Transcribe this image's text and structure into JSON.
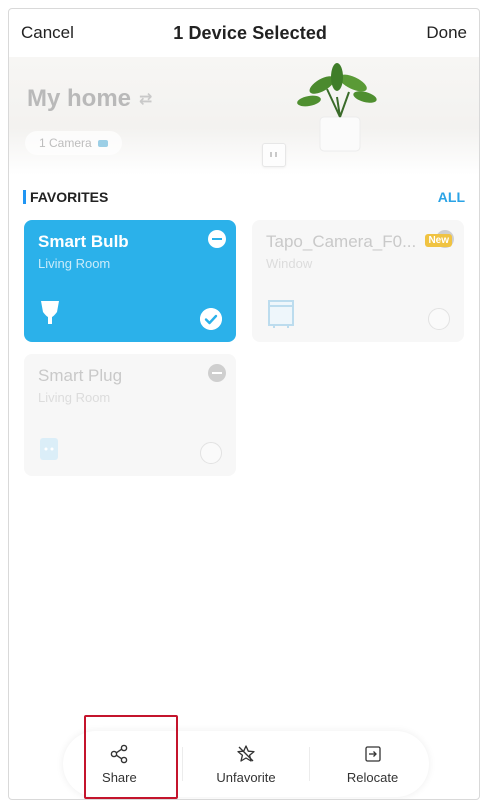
{
  "nav": {
    "cancel": "Cancel",
    "title": "1 Device Selected",
    "done": "Done"
  },
  "home": {
    "title": "My home",
    "camera_count": "1 Camera"
  },
  "favorites": {
    "label": "FAVORITES",
    "all": "ALL"
  },
  "devices": [
    {
      "name": "Smart Bulb",
      "room": "Living Room",
      "selected": true
    },
    {
      "name": "Tapo_Camera_F0...",
      "room": "Window",
      "badge": "New",
      "selected": false
    },
    {
      "name": "Smart Plug",
      "room": "Living Room",
      "selected": false
    }
  ],
  "actions": {
    "share": "Share",
    "unfavorite": "Unfavorite",
    "relocate": "Relocate"
  },
  "colors": {
    "accent": "#2bb1ea",
    "highlight": "#c4142c",
    "badge": "#f0c342"
  }
}
